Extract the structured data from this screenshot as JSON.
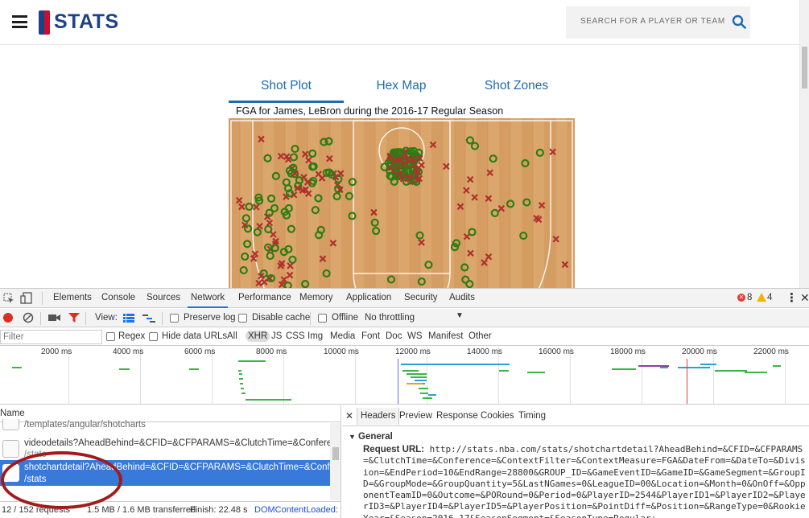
{
  "site": {
    "brand": "STATS",
    "search_placeholder": "SEARCH FOR A PLAYER OR TEAM",
    "tabs": [
      "Shot Plot",
      "Hex Map",
      "Shot Zones"
    ],
    "chart_title": "FGA for James, LeBron during the 2016-17 Regular Season",
    "colors": {
      "made": "#2e7d12",
      "missed": "#b03030",
      "court": "#d9a066",
      "accent": "#1d6bb5"
    }
  },
  "devtools": {
    "tabs": [
      "Elements",
      "Console",
      "Sources",
      "Network",
      "Performance",
      "Memory",
      "Application",
      "Security",
      "Audits"
    ],
    "active_tab": "Network",
    "error_count": "8",
    "warning_count": "4",
    "toolbar": {
      "view_label": "View:",
      "preserve_log": "Preserve log",
      "disable_cache": "Disable cache",
      "offline": "Offline",
      "throttling": "No throttling"
    },
    "filter": {
      "placeholder": "Filter",
      "regex": "Regex",
      "hide_data_urls": "Hide data URLs",
      "types": [
        "All",
        "XHR",
        "JS",
        "CSS",
        "Img",
        "Media",
        "Font",
        "Doc",
        "WS",
        "Manifest",
        "Other"
      ],
      "active_type": "XHR"
    },
    "timeline_labels": [
      "2000 ms",
      "4000 ms",
      "6000 ms",
      "8000 ms",
      "10000 ms",
      "12000 ms",
      "14000 ms",
      "16000 ms",
      "18000 ms",
      "20000 ms",
      "22000 ms"
    ],
    "requests": {
      "column_name": "Name",
      "rows": [
        {
          "line1": "/templates/angular/shotcharts",
          "line2": ""
        },
        {
          "line1": "videodetails?AheadBehind=&CFID=&CFPARAMS=&ClutchTime=&Conference=",
          "line2": "/stats"
        },
        {
          "line1": "shotchartdetail?AheadBehind=&CFID=&CFPARAMS=&ClutchTime=&Conference",
          "line2": "/stats"
        }
      ],
      "status_requests": "12 / 152 requests",
      "status_transferred": "1.5 MB / 1.6 MB transferred",
      "status_finish": "Finish: 22.48 s",
      "status_dcl": "DOMContentLoaded:"
    },
    "detail": {
      "tabs": [
        "Headers",
        "Preview",
        "Response",
        "Cookies",
        "Timing"
      ],
      "active_tab": "Headers",
      "section": "General",
      "request_url_label": "Request URL:",
      "request_url": "http://stats.nba.com/stats/shotchartdetail?AheadBehind=&CFID=&CFPARAMS=&ClutchTime=&Conference=&ContextFilter=&ContextMeasure=FGA&DateFrom=&DateTo=&Division=&EndPeriod=10&EndRange=28800&GROUP_ID=&GameEventID=&GameID=&GameSegment=&GroupID=&GroupMode=&GroupQuantity=5&LastNGames=0&LeagueID=00&Location=&Month=0&OnOff=&OpponentTeamID=0&Outcome=&PORound=0&Period=0&PlayerID=2544&PlayerID1=&PlayerID2=&PlayerID3=&PlayerID4=&PlayerID5=&PlayerPosition=&PointDiff=&Position=&RangeType=0&RookieYear=&Season=2016-17&SeasonSegment=&SeasonType=Regular+"
    }
  }
}
